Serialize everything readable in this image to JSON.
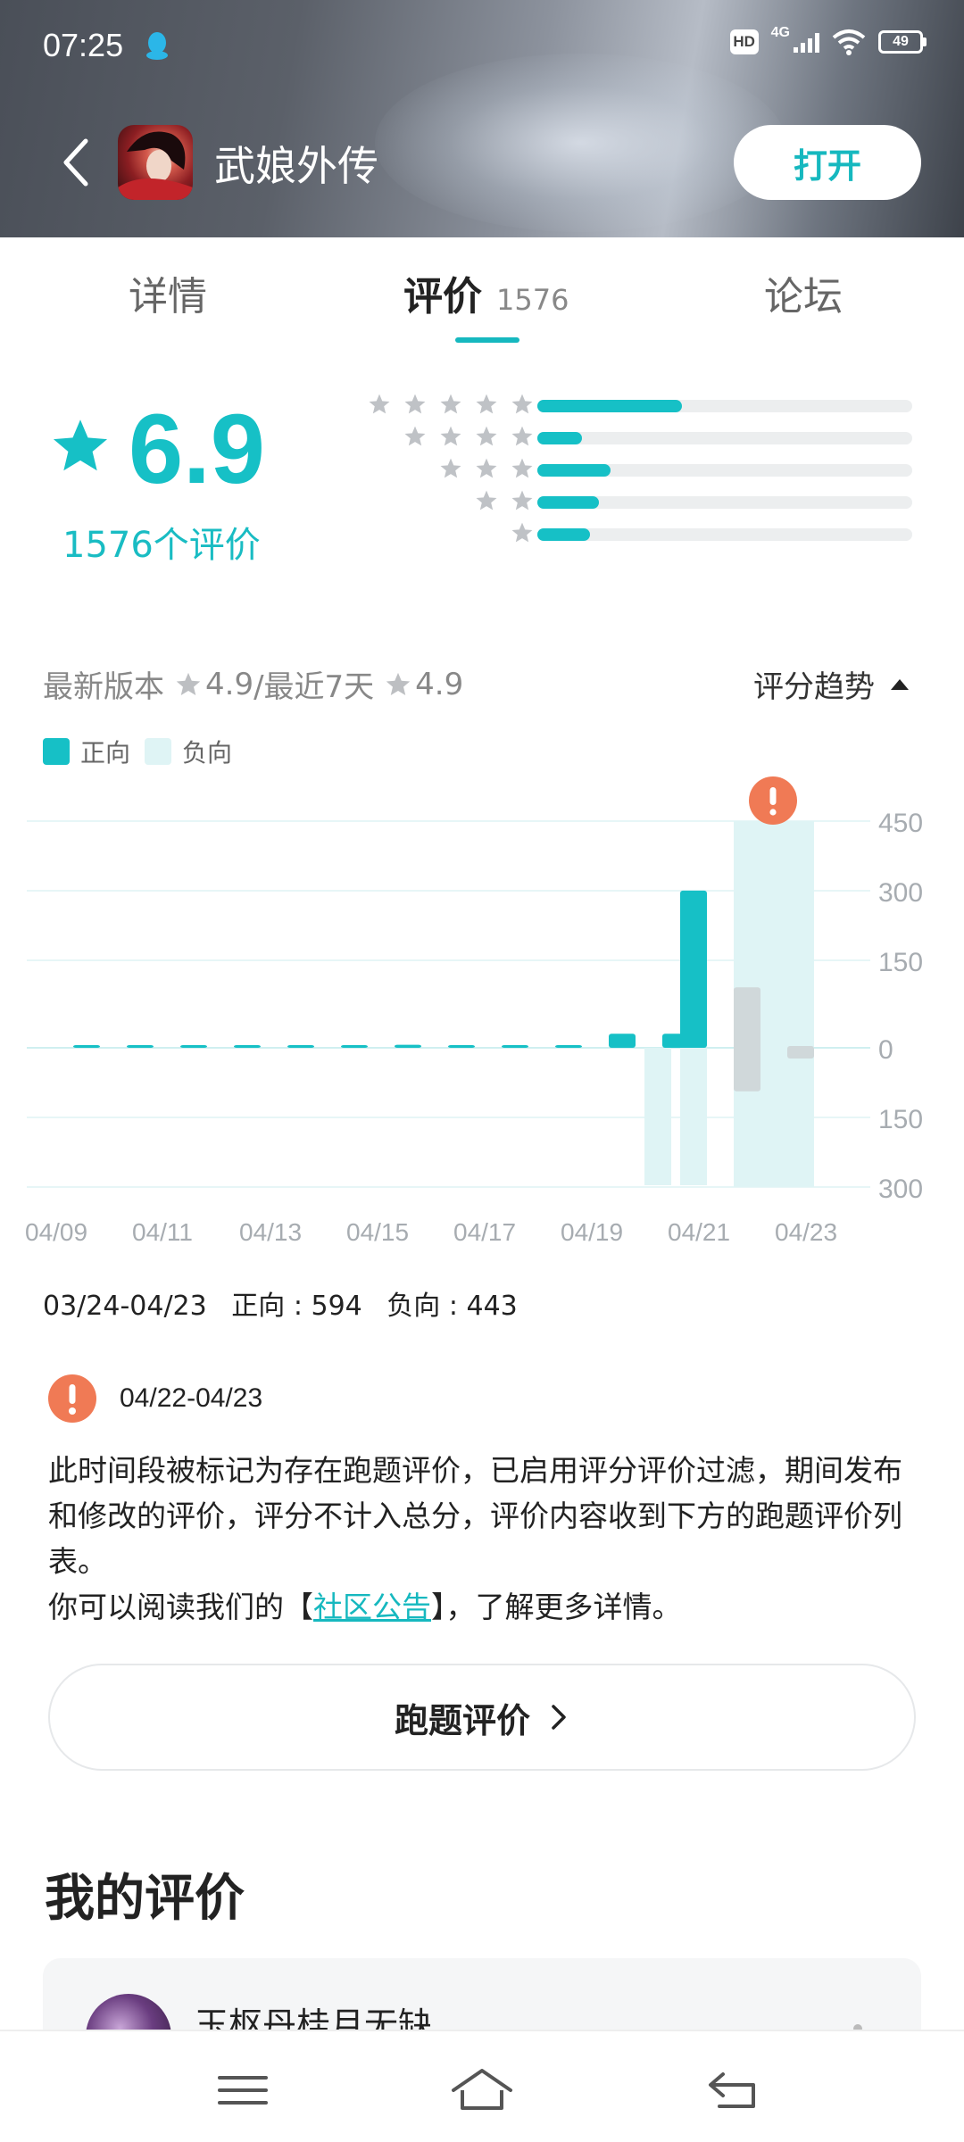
{
  "status_bar": {
    "time": "07:25",
    "hd": "HD",
    "network": "4G",
    "battery": "49"
  },
  "header": {
    "app_name": "武娘外传",
    "open_label": "打开"
  },
  "tabs": [
    {
      "label": "详情"
    },
    {
      "label": "评价",
      "count": "1576"
    },
    {
      "label": "论坛"
    }
  ],
  "rating": {
    "score": "6.9",
    "count_label": "1576个评价",
    "distribution": [
      {
        "stars": 5,
        "fraction": 0.385
      },
      {
        "stars": 4,
        "fraction": 0.12
      },
      {
        "stars": 3,
        "fraction": 0.195
      },
      {
        "stars": 2,
        "fraction": 0.165
      },
      {
        "stars": 1,
        "fraction": 0.14
      }
    ]
  },
  "version": {
    "latest_label": "最新版本",
    "latest_score": "4.9",
    "recent_label": "/最近7天",
    "recent_score": "4.9",
    "trend_label": "评分趋势"
  },
  "legend": {
    "positive": "正向",
    "negative": "负向"
  },
  "colors": {
    "accent": "#16c0c6",
    "negative_fill": "#dff4f5",
    "warning": "#f07a55"
  },
  "chart_data": {
    "type": "bar",
    "x": [
      "04/08",
      "04/09",
      "04/10",
      "04/11",
      "04/12",
      "04/13",
      "04/14",
      "04/15",
      "04/16",
      "04/17",
      "04/18",
      "04/19",
      "04/20",
      "04/21",
      "04/22",
      "04/23"
    ],
    "x_tick_labels": [
      "04/09",
      "04/11",
      "04/13",
      "04/15",
      "04/17",
      "04/19",
      "04/21",
      "04/23"
    ],
    "series": [
      {
        "name": "正向",
        "values": [
          2,
          2,
          5,
          3,
          4,
          3,
          6,
          3,
          3,
          4,
          28,
          28,
          312,
          0,
          0,
          0
        ]
      },
      {
        "name": "负向",
        "values": [
          0,
          0,
          0,
          0,
          0,
          0,
          0,
          0,
          0,
          0,
          0,
          0,
          300,
          0,
          0,
          0
        ]
      }
    ],
    "flagged_index": 14,
    "flagged_ghost": {
      "positive": 120,
      "negative": 95,
      "positive_23": 0,
      "negative_23": 22
    },
    "y_ticks": [
      "450",
      "300",
      "150",
      "0",
      "150",
      "300"
    ],
    "ylim_positive": 450,
    "ylim_negative": 300
  },
  "summary": {
    "range": "03/24-04/23",
    "positive": "正向 : 594",
    "negative": "负向 : 443"
  },
  "notice": {
    "range": "04/22-04/23",
    "text_1": "此时间段被标记为存在跑题评价，已启用评分评价过滤，期间发布和修改的评价，评分不计入总分，评价内容收到下方的跑题评价列表。",
    "text_2_prefix": "你可以阅读我们的【",
    "link": "社区公告",
    "text_2_suffix": "】，了解更多详情。",
    "button": "跑题评价"
  },
  "my_review": {
    "title": "我的评价",
    "user": "玉枢丹桂月无缺"
  }
}
